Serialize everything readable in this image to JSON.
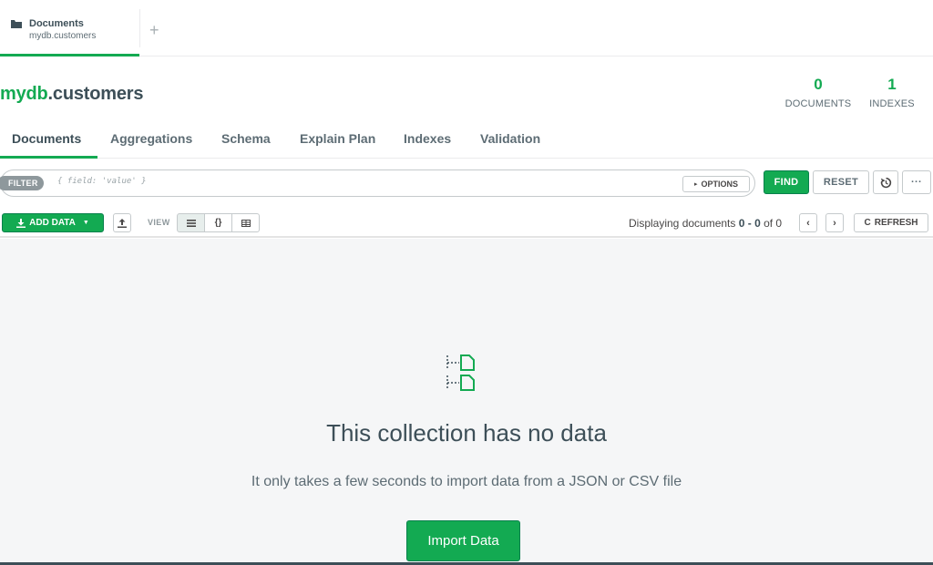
{
  "tab": {
    "title": "Documents",
    "subtitle": "mydb.customers",
    "add_label": "+"
  },
  "collection": {
    "db": "mydb",
    "name": ".customers"
  },
  "stats": {
    "documents_count": "0",
    "documents_label": "DOCUMENTS",
    "indexes_count": "1",
    "indexes_label": "INDEXES"
  },
  "subtabs": [
    {
      "label": "Documents",
      "active": true
    },
    {
      "label": "Aggregations",
      "active": false
    },
    {
      "label": "Schema",
      "active": false
    },
    {
      "label": "Explain Plan",
      "active": false
    },
    {
      "label": "Indexes",
      "active": false
    },
    {
      "label": "Validation",
      "active": false
    }
  ],
  "query": {
    "filter_label": "FILTER",
    "filter_placeholder": "{ field: 'value' }",
    "options_label": "OPTIONS",
    "find_label": "FIND",
    "reset_label": "RESET",
    "more_label": "···"
  },
  "toolbar": {
    "add_data_label": "ADD DATA",
    "view_label": "VIEW",
    "displaying_prefix": "Displaying documents ",
    "displaying_range": "0 - 0",
    "displaying_suffix": " of 0",
    "refresh_label": "REFRESH"
  },
  "empty_state": {
    "title": "This collection has no data",
    "description": "It only takes a few seconds to import data from a JSON or CSV file",
    "import_label": "Import Data"
  },
  "colors": {
    "accent": "#13aa52",
    "text": "#3d4f58"
  }
}
